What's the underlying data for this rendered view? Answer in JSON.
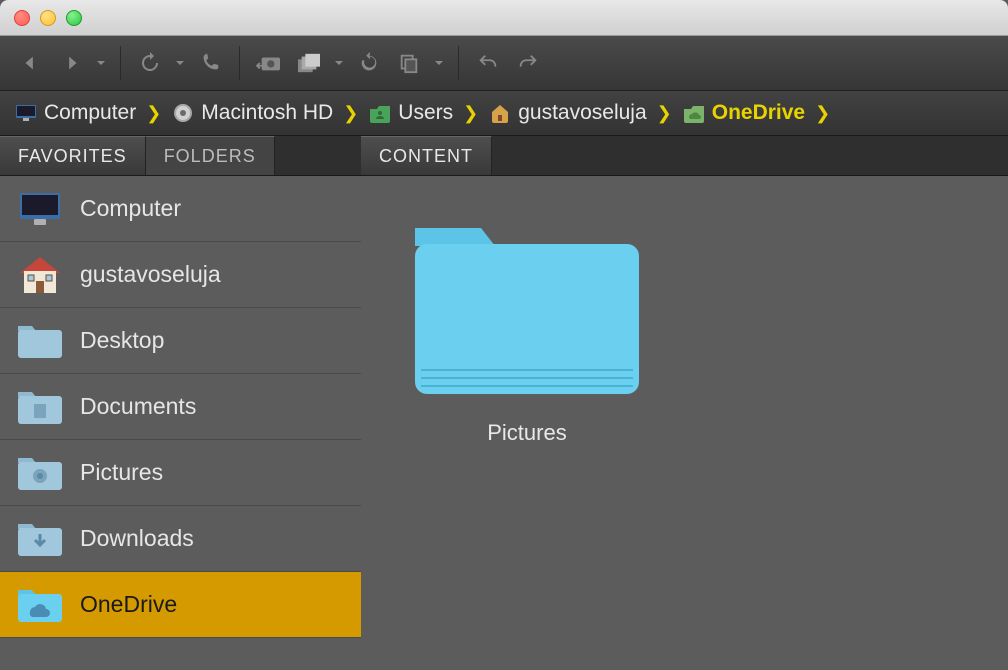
{
  "breadcrumbs": [
    {
      "label": "Computer",
      "active": false
    },
    {
      "label": "Macintosh HD",
      "active": false
    },
    {
      "label": "Users",
      "active": false
    },
    {
      "label": "gustavoseluja",
      "active": false
    },
    {
      "label": "OneDrive",
      "active": true
    }
  ],
  "sidebar": {
    "tabs": {
      "favorites": "FAVORITES",
      "folders": "FOLDERS"
    },
    "items": [
      {
        "label": "Computer"
      },
      {
        "label": "gustavoseluja"
      },
      {
        "label": "Desktop"
      },
      {
        "label": "Documents"
      },
      {
        "label": "Pictures"
      },
      {
        "label": "Downloads"
      },
      {
        "label": "OneDrive"
      }
    ]
  },
  "content": {
    "tab": "CONTENT",
    "items": [
      {
        "label": "Pictures"
      }
    ]
  }
}
